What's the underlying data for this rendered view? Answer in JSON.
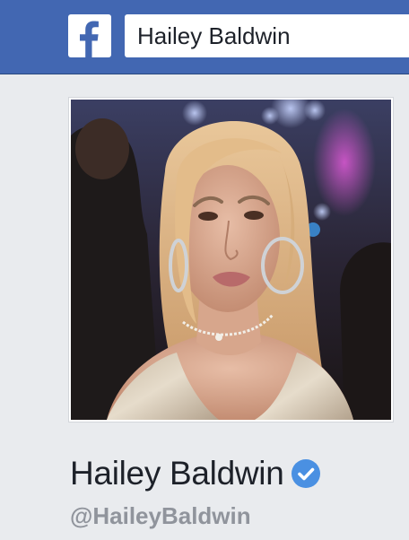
{
  "header": {
    "logo_icon": "facebook-f-icon",
    "search_value": "Hailey Baldwin",
    "bar_color": "#4267b2"
  },
  "profile": {
    "photo_icon": "profile-photo",
    "name": "Hailey Baldwin",
    "verified_icon": "verified-badge-icon",
    "verified_color": "#4a90e2",
    "username": "@HaileyBaldwin"
  }
}
